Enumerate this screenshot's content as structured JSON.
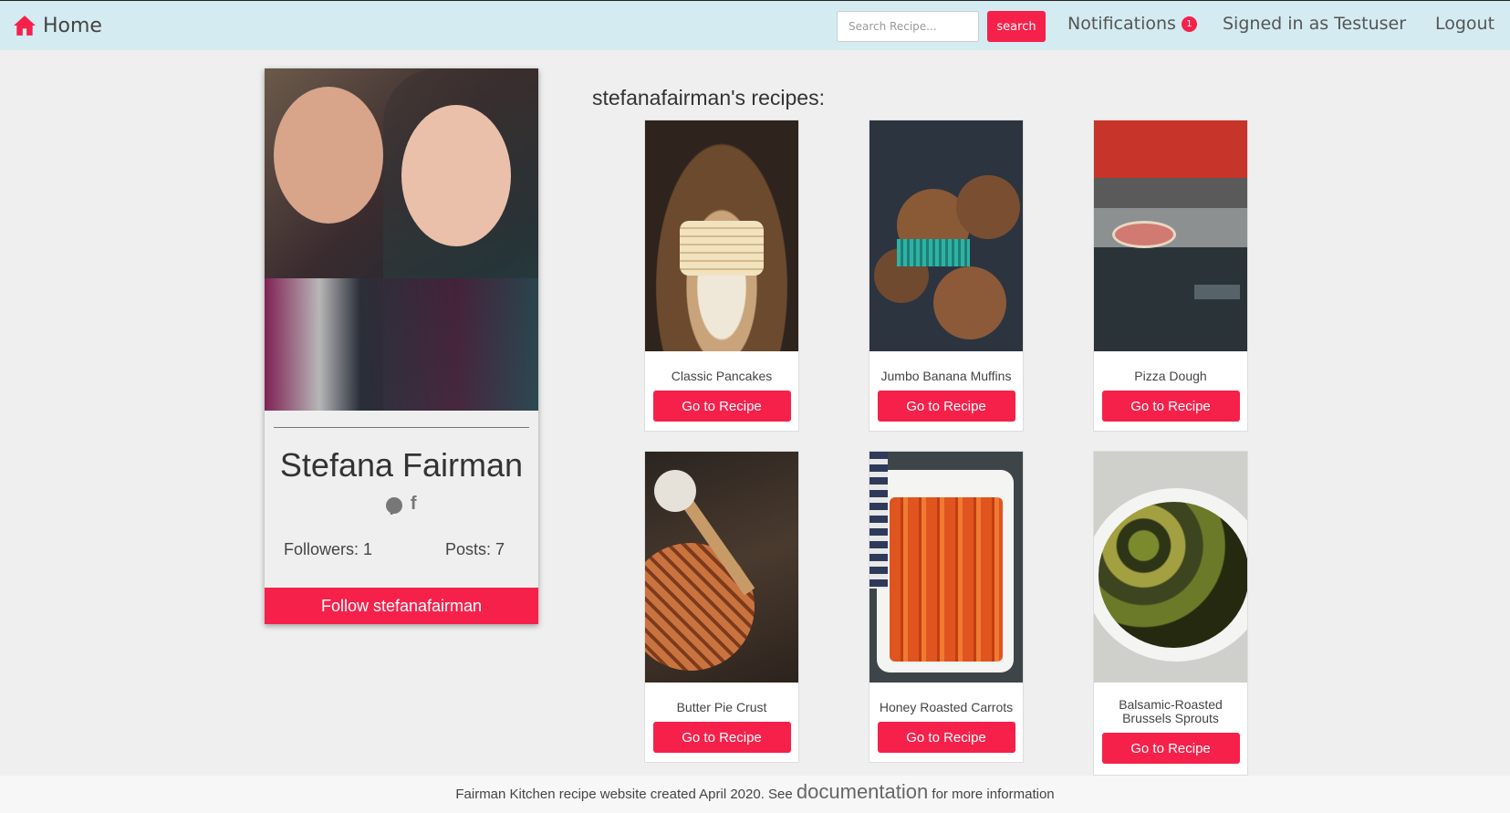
{
  "nav": {
    "home_label": "Home",
    "search_placeholder": "Search Recipe...",
    "search_button": "search",
    "notifications_label": "Notifications",
    "notifications_count": "1",
    "signed_in_label": "Signed in as Testuser",
    "logout_label": "Logout",
    "accent_color": "#f5214a",
    "bg_color": "#d4ebf1"
  },
  "profile": {
    "name": "Stefana Fairman",
    "social_icons": [
      "pinterest-icon",
      "facebook-icon"
    ],
    "followers_label": "Followers: 1",
    "posts_label": "Posts: 7",
    "follow_button": "Follow stefanafairman"
  },
  "recipes": {
    "heading": "stefanafairman's recipes:",
    "items": [
      {
        "title": "Classic Pancakes",
        "button": "Go to Recipe"
      },
      {
        "title": "Jumbo Banana Muffins",
        "button": "Go to Recipe"
      },
      {
        "title": "Pizza Dough",
        "button": "Go to Recipe"
      },
      {
        "title": "Butter Pie Crust",
        "button": "Go to Recipe"
      },
      {
        "title": "Honey Roasted Carrots",
        "button": "Go to Recipe"
      },
      {
        "title": "Balsamic-Roasted Brussels Sprouts",
        "button": "Go to Recipe"
      }
    ]
  },
  "footer": {
    "text_before": "Fairman Kitchen recipe website created April 2020. See",
    "link_text": "documentation",
    "text_after": "for more information"
  }
}
